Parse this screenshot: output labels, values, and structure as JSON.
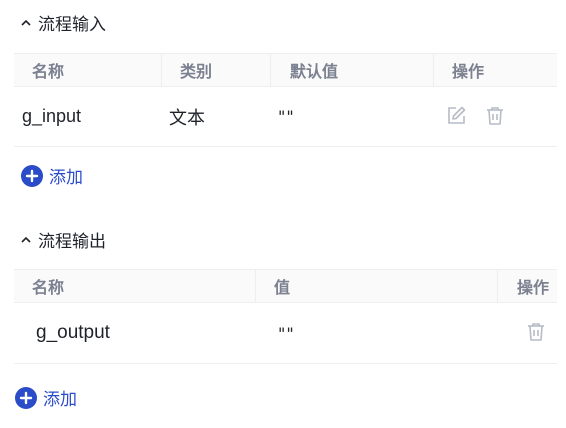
{
  "colors": {
    "accent": "#2b4cc9",
    "header_text": "#7b8190",
    "icon": "#b6bbc6"
  },
  "input_section": {
    "title": "流程输入",
    "columns": [
      "名称",
      "类别",
      "默认值",
      "操作"
    ],
    "rows": [
      {
        "name": "g_input",
        "type": "文本",
        "default": "\"\""
      }
    ],
    "icons": [
      "edit-icon",
      "trash-icon"
    ],
    "add_label": "添加"
  },
  "output_section": {
    "title": "流程输出",
    "columns": [
      "名称",
      "值",
      "操作"
    ],
    "rows": [
      {
        "name": "g_output",
        "value": "\"\""
      }
    ],
    "icons": [
      "trash-icon"
    ],
    "add_label": "添加"
  }
}
